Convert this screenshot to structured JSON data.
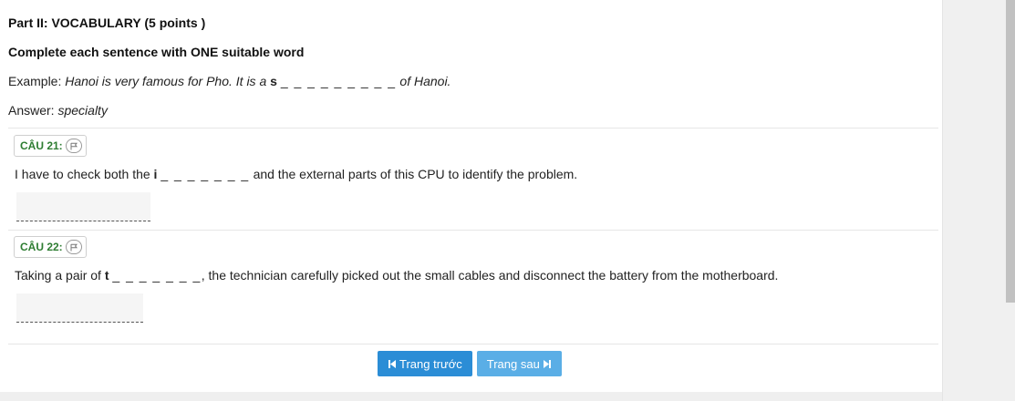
{
  "section": {
    "title": "Part II: VOCABULARY (5 points )",
    "instruction": "Complete each sentence with ONE suitable word",
    "example_label": "Example:",
    "example_text_before": "Hanoi is very famous for Pho. It is a",
    "example_letter": "s",
    "example_blank": "_ _ _ _ _ _ _ _ _",
    "example_text_after": "of Hanoi.",
    "answer_label": "Answer:",
    "answer_value": "specialty"
  },
  "questions": [
    {
      "tag": "CÂU 21:",
      "text_before": "I have to check both the",
      "letter": "i",
      "blank": "_ _ _ _ _ _ _",
      "text_after": "and the external parts of this CPU to identify the problem.",
      "answer": ""
    },
    {
      "tag": "CÂU 22:",
      "text_before": "Taking a pair of",
      "letter": "t",
      "blank": "_ _ _ _ _ _ _",
      "text_after": ", the technician carefully picked out the small cables and disconnect the battery from the motherboard.",
      "answer": ""
    }
  ],
  "navigation": {
    "prev_label": "Trang trước",
    "next_label": "Trang sau"
  },
  "colors": {
    "question_tag": "#2e7d32",
    "prev_button": "#2b8dd6",
    "next_button": "#5aaee6"
  },
  "icons": [
    "flag-icon",
    "skip-prev-icon",
    "skip-next-icon"
  ]
}
